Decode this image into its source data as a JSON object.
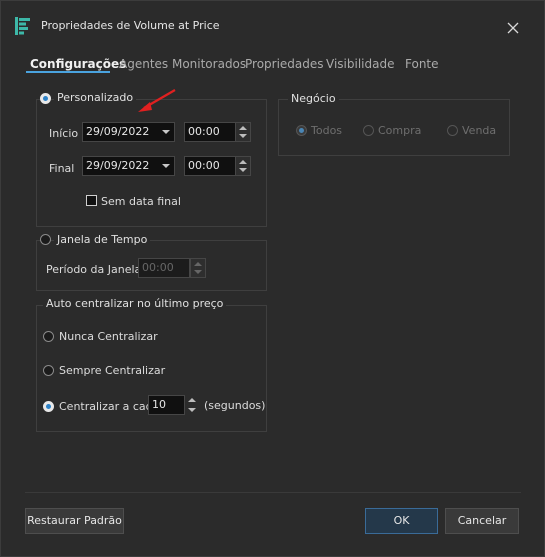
{
  "window": {
    "title": "Propriedades de Volume at Price"
  },
  "icons": {
    "app": "volume-at-price-icon",
    "close": "close-icon"
  },
  "tabs": [
    {
      "label": "Configurações",
      "active": true
    },
    {
      "label": "Agentes Monitorados",
      "active": false
    },
    {
      "label": "Propriedades",
      "active": false
    },
    {
      "label": "Visibilidade",
      "active": false
    },
    {
      "label": "Fonte",
      "active": false
    }
  ],
  "periodo": {
    "personalizado": {
      "label": "Personalizado",
      "selected": true
    },
    "inicio": {
      "label": "Início",
      "date": "29/09/2022",
      "time": "00:00"
    },
    "final": {
      "label": "Final",
      "date": "29/09/2022",
      "time": "00:00"
    },
    "sem_data_final": {
      "label": "Sem data final",
      "checked": false
    },
    "janela": {
      "label": "Janela de Tempo",
      "selected": false,
      "periodo_label": "Período da Janela",
      "periodo_value": "00:00"
    }
  },
  "auto": {
    "title": "Auto centralizar no último preço",
    "nunca": {
      "label": "Nunca Centralizar",
      "selected": false
    },
    "sempre": {
      "label": "Sempre Centralizar",
      "selected": false
    },
    "cada": {
      "label": "Centralizar a cada",
      "selected": true,
      "value": "10",
      "unit": "(segundos)"
    }
  },
  "negocio": {
    "title": "Negócio",
    "todos": {
      "label": "Todos",
      "selected": true
    },
    "compra": {
      "label": "Compra",
      "selected": false
    },
    "venda": {
      "label": "Venda",
      "selected": false
    }
  },
  "footer": {
    "restore": "Restaurar Padrão",
    "ok": "OK",
    "cancel": "Cancelar"
  },
  "colors": {
    "accent": "#2d82c7",
    "annotation_arrow": "#e02020"
  }
}
